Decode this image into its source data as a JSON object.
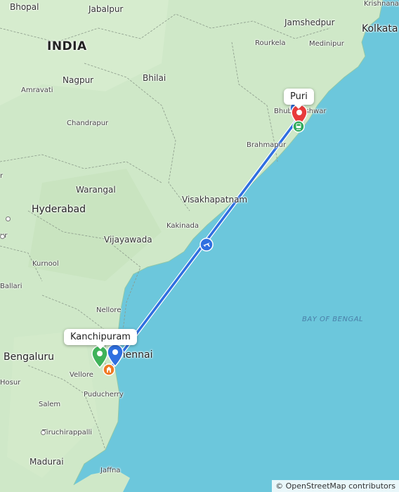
{
  "map": {
    "country_label": "INDIA",
    "sea_label": "BAY OF BENGAL",
    "attribution": "© OpenStreetMap contributors",
    "route_color": "#2f6fe0",
    "sea_color": "#6cc7dc",
    "land_color": "#cfe8c8",
    "cities": {
      "bhopal": "Bhopal",
      "jabalpur": "Jabalpur",
      "krishnanagar": "Krishnanag",
      "jamshedpur": "Jamshedpur",
      "kolkata": "Kolkata",
      "rourkela": "Rourkela",
      "medinipur": "Medinipur",
      "nagpur": "Nagpur",
      "bhilai": "Bhilai",
      "amravati": "Amravati",
      "chandrapur": "Chandrapur",
      "bhubaneswar": "Bhubaneshwar",
      "brahmapur": "Brahmapur",
      "warangal": "Warangal",
      "hyderabad": "Hyderabad",
      "visakhapatnam": "Visakhapatnam",
      "kakinada": "Kakinada",
      "vijayawada": "Vijayawada",
      "kurnool": "Kurnool",
      "ballari": "Ballari",
      "nellore": "Nellore",
      "chennai": "Chennai",
      "bengaluru": "Bengaluru",
      "vellore": "Vellore",
      "hosur": "Hosur",
      "puducherry": "Puducherry",
      "salem": "Salem",
      "tiruchirappalli": "Tiruchirappalli",
      "madurai": "Madurai",
      "jaffna": "Jaffna",
      "edge_left_1": "r",
      "edge_left_2": "ur"
    },
    "callouts": {
      "puri": "Puri",
      "kanchipuram": "Kanchipuram"
    },
    "icons": {
      "origin_marker": "blue-pin-icon",
      "destination_marker": "red-pin-icon",
      "waypoint_marker": "green-pin-icon",
      "flight": "airplane-icon",
      "train": "train-icon",
      "temple": "temple-icon"
    }
  }
}
